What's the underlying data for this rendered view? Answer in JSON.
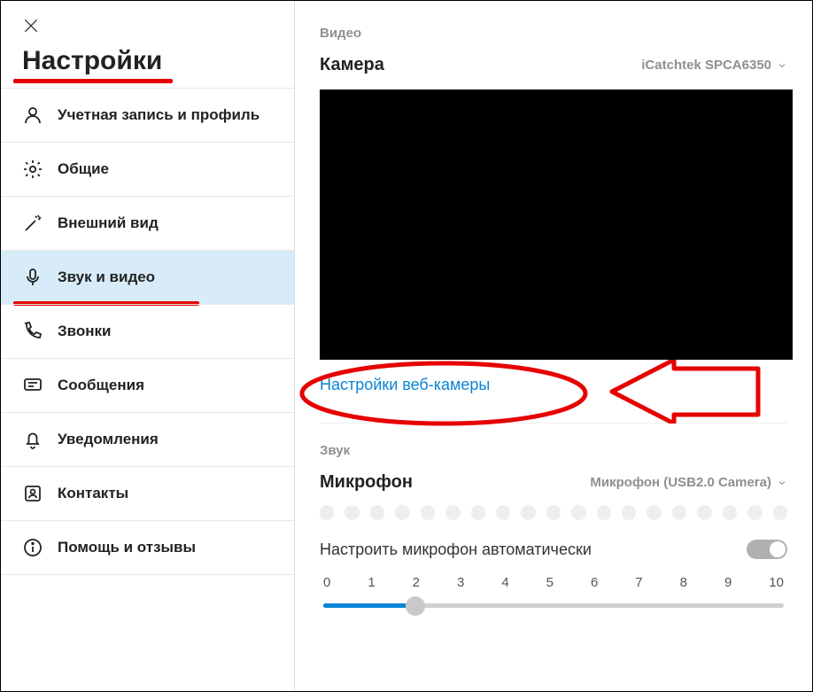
{
  "title": "Настройки",
  "sidebar": {
    "items": [
      {
        "label": "Учетная запись и профиль"
      },
      {
        "label": "Общие"
      },
      {
        "label": "Внешний вид"
      },
      {
        "label": "Звук и видео"
      },
      {
        "label": "Звонки"
      },
      {
        "label": "Сообщения"
      },
      {
        "label": "Уведомления"
      },
      {
        "label": "Контакты"
      },
      {
        "label": "Помощь и отзывы"
      }
    ],
    "active_index": 3
  },
  "video": {
    "section_label": "Видео",
    "camera_label": "Камера",
    "camera_value": "iCatchtek SPCA6350",
    "webcam_settings_link": "Настройки веб-камеры"
  },
  "sound": {
    "section_label": "Звук",
    "mic_label": "Микрофон",
    "mic_value": "Микрофон (USB2.0 Camera)",
    "auto_adjust": "Настроить микрофон автоматически",
    "auto_adjust_on": true,
    "slider_labels": [
      "0",
      "1",
      "2",
      "3",
      "4",
      "5",
      "6",
      "7",
      "8",
      "9",
      "10"
    ],
    "slider_value": 2
  }
}
